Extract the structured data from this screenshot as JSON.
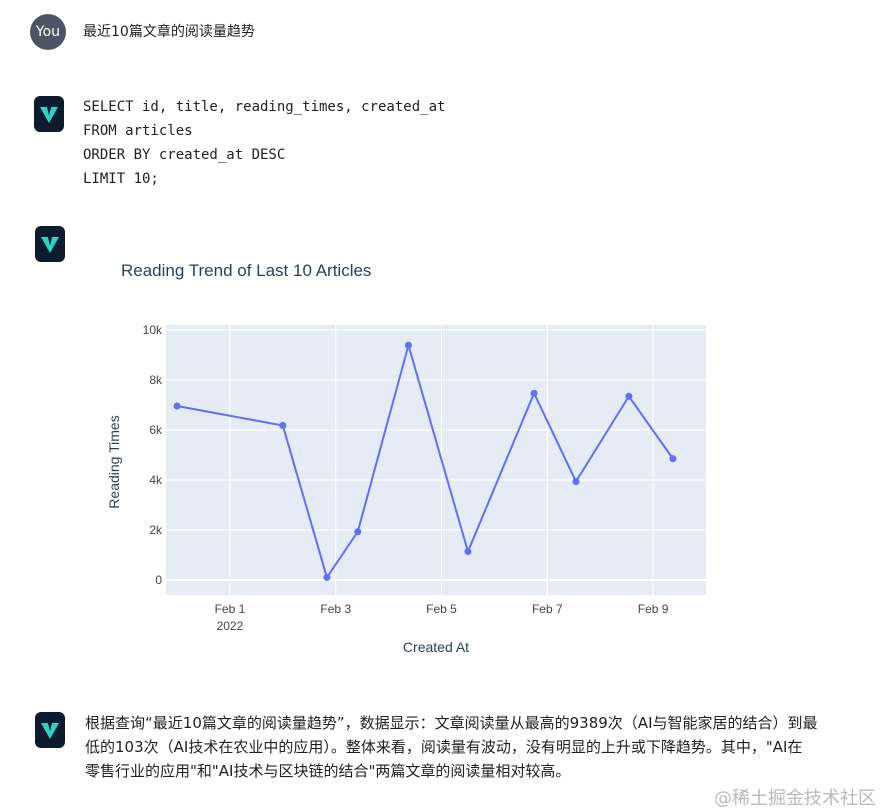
{
  "user_message": {
    "avatar_label": "You",
    "text": "最近10篇文章的阅读量趋势"
  },
  "sql_message": {
    "lines": [
      "SELECT id, title, reading_times, created_at",
      "FROM articles",
      "ORDER BY created_at DESC",
      "LIMIT 10;"
    ]
  },
  "chart_data": {
    "type": "line",
    "title": "Reading Trend of Last 10 Articles",
    "xlabel": "Created At",
    "ylabel": "Reading Times",
    "x": [
      "2022-01-31",
      "2022-02-02",
      "2022-02-02 20:00",
      "2022-02-03 10:00",
      "2022-02-04 09:00",
      "2022-02-05 12:00",
      "2022-02-06 18:00",
      "2022-02-07 13:00",
      "2022-02-08 13:00",
      "2022-02-09 09:00"
    ],
    "series": [
      {
        "values": [
          6960,
          6180,
          103,
          1930,
          9389,
          1140,
          7470,
          3940,
          7350,
          4850
        ],
        "color": "#636efa"
      }
    ],
    "ylim": [
      -600,
      10200
    ],
    "y_ticks": [
      0,
      2000,
      4000,
      6000,
      8000,
      10000
    ],
    "y_tick_labels": [
      "0",
      "2k",
      "4k",
      "6k",
      "8k",
      "10k"
    ],
    "x_ticks": [
      "2022-02-01",
      "2022-02-03",
      "2022-02-05",
      "2022-02-07",
      "2022-02-09"
    ],
    "x_tick_labels": [
      "Feb 1",
      "Feb 3",
      "Feb 5",
      "Feb 7",
      "Feb 9"
    ],
    "x_tick_sublabel": "2022",
    "plot_bg": "#e5ecf6",
    "grid": true
  },
  "answer_message": {
    "lines": [
      "根据查询“最近10篇文章的阅读量趋势”，数据显示：文章阅读量从最高的9389次（AI与智能家居的结合）到最",
      "低的103次（AI技术在农业中的应用）。整体来看，阅读量有波动，没有明显的上升或下降趋势。其中，\"AI在",
      "零售行业的应用\"和\"AI技术与区块链的结合\"两篇文章的阅读量相对较高。"
    ]
  },
  "watermark": "@稀土掘金技术社区",
  "colors": {
    "avatar_bg": "#4d5466",
    "bot_icon_bg": "#0d1b2e",
    "bot_icon_accent": "#2ad4c2"
  }
}
